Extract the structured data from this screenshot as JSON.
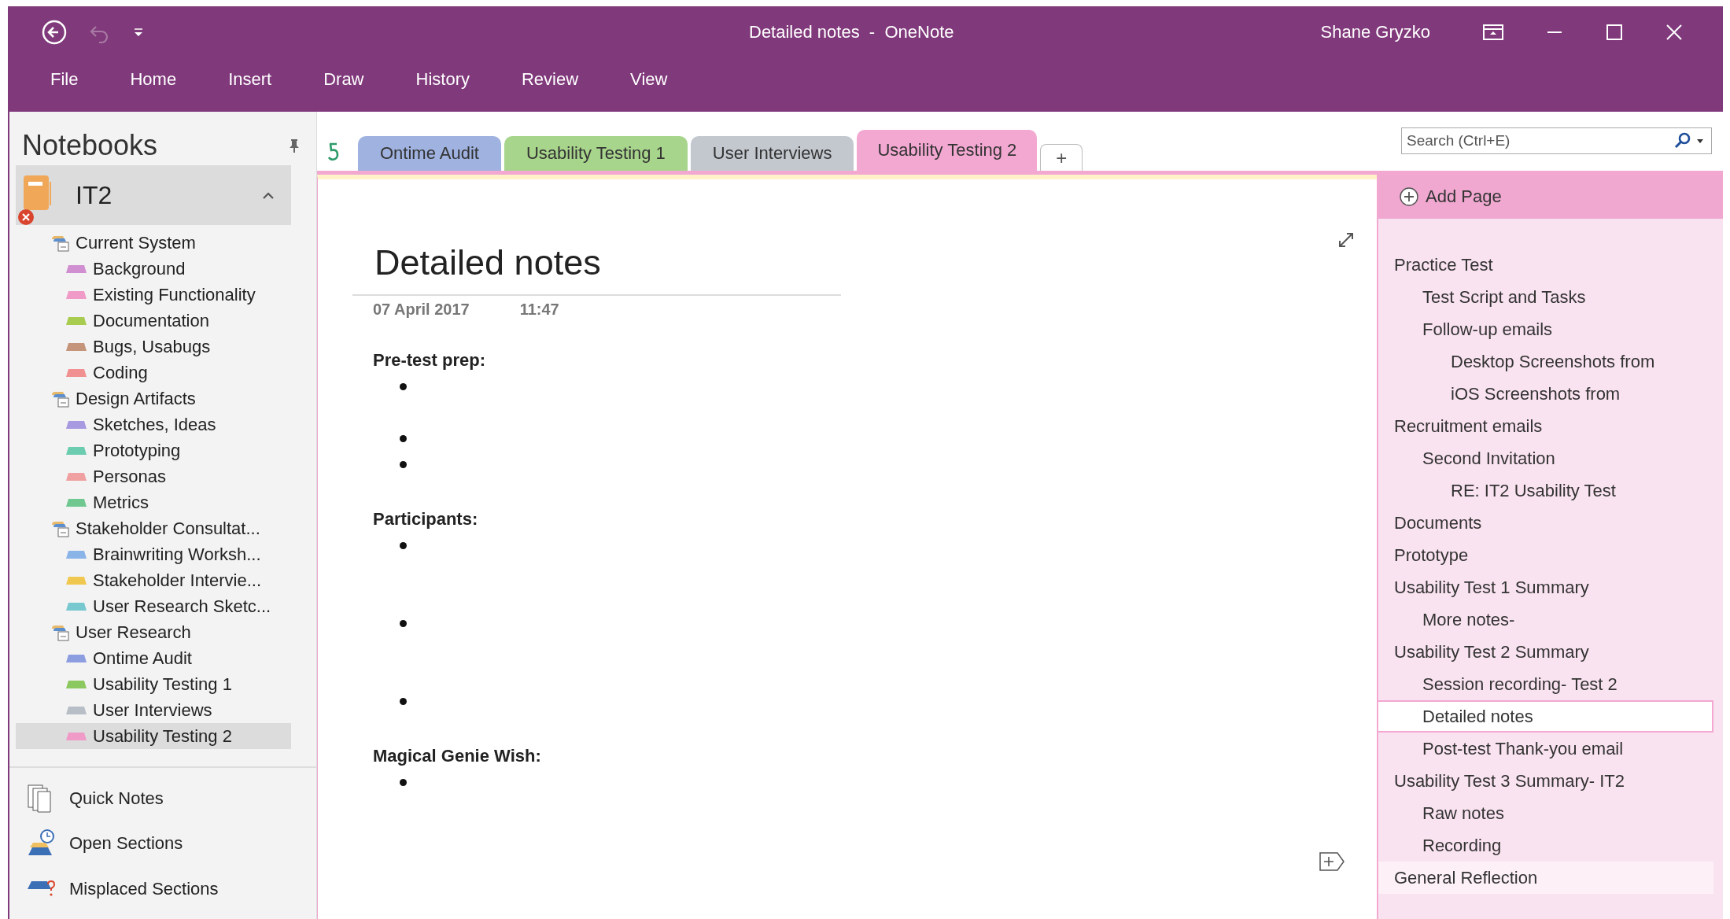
{
  "window": {
    "title": "Detailed notes  -  OneNote",
    "user": "Shane Gryzko"
  },
  "ribbon": {
    "tabs": [
      {
        "label": "File"
      },
      {
        "label": "Home"
      },
      {
        "label": "Insert"
      },
      {
        "label": "Draw"
      },
      {
        "label": "History"
      },
      {
        "label": "Review"
      },
      {
        "label": "View"
      }
    ]
  },
  "sidebar": {
    "title": "Notebooks",
    "notebook": {
      "name": "IT2",
      "expanded": true,
      "sync_error": true
    },
    "groups": [
      {
        "name": "Current System",
        "sections": [
          {
            "name": "Background",
            "color": "#d08fd0",
            "selected": false
          },
          {
            "name": "Existing Functionality",
            "color": "#f09ac8",
            "selected": false
          },
          {
            "name": "Documentation",
            "color": "#a8cc50",
            "selected": false
          },
          {
            "name": "Bugs, Usabugs",
            "color": "#c4957a",
            "selected": false
          },
          {
            "name": "Coding",
            "color": "#f09090",
            "selected": false
          }
        ]
      },
      {
        "name": "Design Artifacts",
        "sections": [
          {
            "name": "Sketches, Ideas",
            "color": "#a89ae0",
            "selected": false
          },
          {
            "name": "Prototyping",
            "color": "#6cccb0",
            "selected": false
          },
          {
            "name": "Personas",
            "color": "#f0a0a0",
            "selected": false
          },
          {
            "name": "Metrics",
            "color": "#70c890",
            "selected": false
          }
        ]
      },
      {
        "name": "Stakeholder Consultat...",
        "sections": [
          {
            "name": "Brainwriting Worksh...",
            "color": "#8ab4e8",
            "selected": false
          },
          {
            "name": "Stakeholder Intervie...",
            "color": "#f0c850",
            "selected": false
          },
          {
            "name": "User Research Sketc...",
            "color": "#78c8d0",
            "selected": false
          }
        ]
      },
      {
        "name": "User Research",
        "sections": [
          {
            "name": "Ontime Audit",
            "color": "#8c9ee0",
            "selected": false
          },
          {
            "name": "Usability Testing 1",
            "color": "#8cc860",
            "selected": false
          },
          {
            "name": "User Interviews",
            "color": "#b8bec6",
            "selected": false
          },
          {
            "name": "Usability Testing 2",
            "color": "#f09ac8",
            "selected": true
          }
        ]
      }
    ],
    "footer": [
      {
        "label": "Quick Notes",
        "kind": "quick"
      },
      {
        "label": "Open Sections",
        "kind": "open"
      },
      {
        "label": "Misplaced Sections",
        "kind": "misplaced"
      }
    ]
  },
  "section_tabs": [
    {
      "label": "Ontime Audit",
      "color": "#9fb2e0",
      "selected": false
    },
    {
      "label": "Usability Testing 1",
      "color": "#a8d58c",
      "selected": false
    },
    {
      "label": "User Interviews",
      "color": "#c3c8cf",
      "selected": false
    },
    {
      "label": "Usability Testing 2",
      "color": "#f3a8d2",
      "selected": true
    }
  ],
  "add_tab": "+",
  "search": {
    "placeholder": "Search (Ctrl+E)"
  },
  "page": {
    "title": "Detailed notes",
    "date": "07 April 2017",
    "time": "11:47",
    "blocks": [
      {
        "heading": "Pre-test prep:",
        "lines": [
          {
            "kind": "bullet"
          },
          {
            "kind": "continuation"
          },
          {
            "kind": "bullet"
          },
          {
            "kind": "bullet"
          }
        ]
      },
      {
        "heading": "Participants:",
        "lines": [
          {
            "kind": "bullet"
          },
          {
            "kind": "continuation"
          },
          {
            "kind": "continuation"
          },
          {
            "kind": "bullet"
          },
          {
            "kind": "continuation"
          },
          {
            "kind": "continuation"
          },
          {
            "kind": "bullet"
          }
        ]
      },
      {
        "heading": "Magical Genie Wish:",
        "lines": [
          {
            "kind": "bullet"
          }
        ]
      }
    ]
  },
  "pages": {
    "add_label": "Add Page",
    "items": [
      {
        "title": "Practice Test",
        "selected": false,
        "highlighted": false,
        "children": [
          {
            "title": "Test Script and Tasks",
            "selected": false,
            "highlighted": false
          },
          {
            "title": "Follow-up emails",
            "selected": false,
            "highlighted": false,
            "children": [
              {
                "title": "Desktop Screenshots from",
                "selected": false,
                "highlighted": false
              },
              {
                "title": "iOS Screenshots from",
                "selected": false,
                "highlighted": false
              }
            ]
          }
        ]
      },
      {
        "title": "Recruitment emails",
        "selected": false,
        "highlighted": false,
        "children": [
          {
            "title": "Second Invitation",
            "selected": false,
            "highlighted": false,
            "children": [
              {
                "title": "RE: IT2 Usability Test",
                "selected": false,
                "highlighted": false
              }
            ]
          }
        ]
      },
      {
        "title": "Documents",
        "selected": false,
        "highlighted": false
      },
      {
        "title": "Prototype",
        "selected": false,
        "highlighted": false
      },
      {
        "title": "Usability Test 1 Summary",
        "selected": false,
        "highlighted": false,
        "children": [
          {
            "title": "More notes-",
            "selected": false,
            "highlighted": false
          }
        ]
      },
      {
        "title": "Usability Test 2 Summary",
        "selected": false,
        "highlighted": false,
        "children": [
          {
            "title": "Session recording- Test 2",
            "selected": false,
            "highlighted": false
          },
          {
            "title": "Detailed notes",
            "selected": true,
            "highlighted": false
          },
          {
            "title": "Post-test Thank-you email",
            "selected": false,
            "highlighted": false
          }
        ]
      },
      {
        "title": "Usability Test 3 Summary- IT2",
        "selected": false,
        "highlighted": false,
        "children": [
          {
            "title": "Raw notes",
            "selected": false,
            "highlighted": false
          },
          {
            "title": "Recording",
            "selected": false,
            "highlighted": false
          }
        ]
      },
      {
        "title": "General Reflection",
        "selected": false,
        "highlighted": true
      }
    ]
  }
}
